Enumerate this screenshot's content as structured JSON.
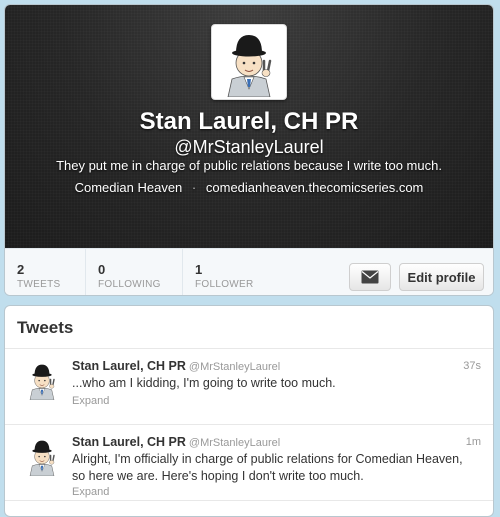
{
  "profile": {
    "name": "Stan Laurel, CH PR",
    "handle": "@MrStanleyLaurel",
    "bio": "They put me in charge of public relations because I write too much.",
    "location": "Comedian Heaven",
    "separator": "·",
    "url": "comedianheaven.thecomicseries.com",
    "avatar_icon": "cartoon-bowler-hat-man-avatar"
  },
  "stats": {
    "tweets": {
      "count": "2",
      "label": "TWEETS"
    },
    "following": {
      "count": "0",
      "label": "FOLLOWING"
    },
    "followers": {
      "count": "1",
      "label": "FOLLOWER"
    }
  },
  "actions": {
    "dm_icon": "envelope-icon",
    "edit_profile_label": "Edit profile"
  },
  "tweets_section": {
    "title": "Tweets",
    "items": [
      {
        "name": "Stan Laurel, CH PR",
        "handle": "@MrStanleyLaurel",
        "time": "37s",
        "text": "...who am I kidding, I'm going to write too much.",
        "expand": "Expand"
      },
      {
        "name": "Stan Laurel, CH PR",
        "handle": "@MrStanleyLaurel",
        "time": "1m",
        "text": "Alright, I'm officially in charge of public relations for Comedian Heaven, so here we are. Here's hoping I don't write too much.",
        "expand": "Expand"
      }
    ]
  },
  "colors": {
    "page_background": "#c0deed",
    "header_background": "#262626",
    "muted_text": "#999999"
  }
}
